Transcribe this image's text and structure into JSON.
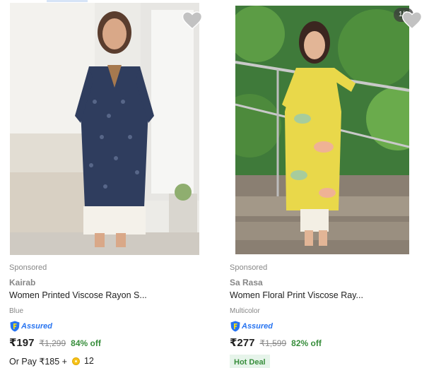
{
  "products": [
    {
      "sponsored": "Sponsored",
      "brand": "Kairab",
      "title": "Women Printed Viscose Rayon S...",
      "color": "Blue",
      "assured": "Assured",
      "price": "₹197",
      "mrp": "₹1,299",
      "discount": "84% off",
      "pay_prefix": "Or Pay ₹185 +",
      "coins": "12",
      "image_icon": "kurta-photo-navy-printed",
      "wishlist_icon": "heart-icon"
    },
    {
      "sponsored": "Sponsored",
      "brand": "Sa Rasa",
      "title": "Women Floral Print Viscose Ray...",
      "color": "Multicolor",
      "assured": "Assured",
      "price": "₹277",
      "mrp": "₹1,599",
      "discount": "82% off",
      "image_counter": "1/9",
      "badge": "Hot Deal",
      "image_icon": "kurta-photo-yellow-floral",
      "wishlist_icon": "heart-icon"
    }
  ],
  "colors": {
    "discount_green": "#388e3c",
    "assured_blue": "#2874f0",
    "muted_text": "#878787"
  }
}
